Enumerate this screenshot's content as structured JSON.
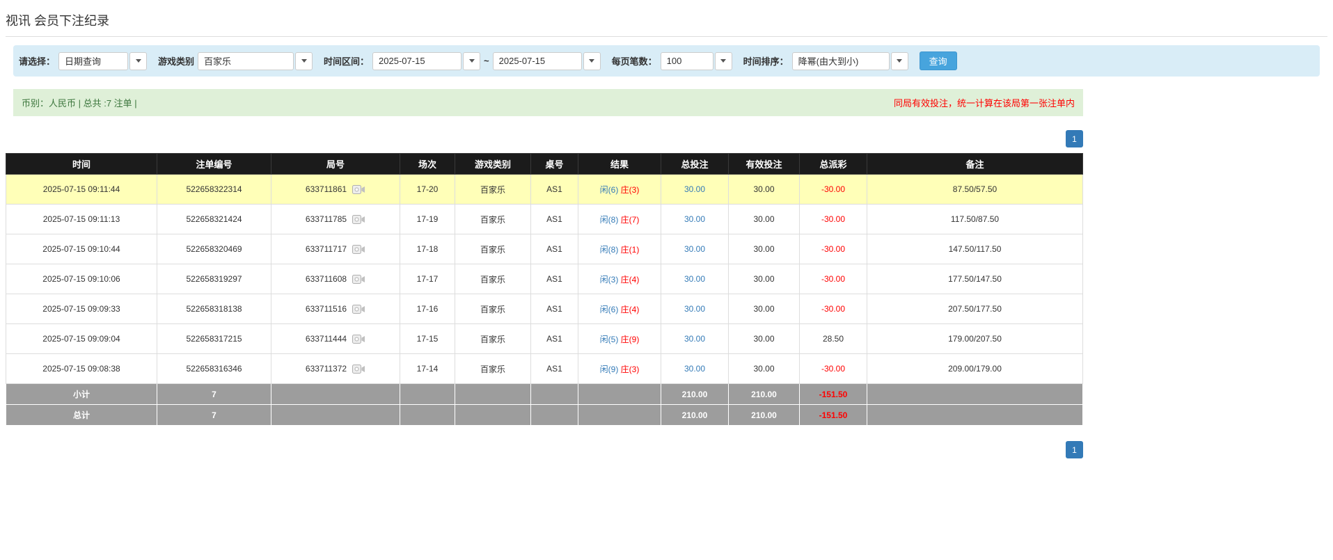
{
  "page": {
    "title": "视讯 会员下注纪录"
  },
  "filters": {
    "select_label": "请选择：",
    "select_value": "日期查询",
    "game_type_label": "游戏类别",
    "game_type_value": "百家乐",
    "date_range_label": "时间区间：",
    "date_from": "2025-07-15",
    "date_separator": "~",
    "date_to": "2025-07-15",
    "page_size_label": "每页笔数：",
    "page_size_value": "100",
    "sort_label": "时间排序：",
    "sort_value": "降幂(由大到小)",
    "search_button": "查询"
  },
  "summary": {
    "left_text": "币别：人民币 | 总共 :7 注单 |",
    "right_note": "同局有效投注，统一计算在该局第一张注单内"
  },
  "pagination": {
    "page": "1"
  },
  "icons": {
    "dropdown": "chevron-down-icon",
    "round_replay": "video-replay-icon"
  },
  "colors": {
    "filter_bar_blue": "#d9edf7",
    "summary_bar_green": "#dff0d8",
    "search_button_blue": "#47a4dd",
    "pagination_blue": "#337ab7",
    "link_blue": "#337ab7",
    "player_blue": "#337ab7",
    "banker_red": "#ff0000",
    "negative_red": "#ff0000",
    "note_red": "#ff0000",
    "highlight_yellow": "#ffffb8",
    "header_black": "#1b1b1b",
    "footer_gray": "#9d9d9d"
  },
  "table": {
    "headers": [
      "时间",
      "注单编号",
      "局号",
      "场次",
      "游戏类别",
      "桌号",
      "结果",
      "总投注",
      "有效投注",
      "总派彩",
      "备注"
    ],
    "rows": [
      {
        "time": "2025-07-15 09:11:44",
        "bet_id": "522658322314",
        "round": "633711861",
        "session": "17-20",
        "game": "百家乐",
        "table_no": "AS1",
        "result_xian": "闲(6)",
        "result_zhuang": "庄(3)",
        "total_bet": "30.00",
        "valid_bet": "30.00",
        "payout": "-30.00",
        "remark": "87.50/57.50",
        "highlight": true
      },
      {
        "time": "2025-07-15 09:11:13",
        "bet_id": "522658321424",
        "round": "633711785",
        "session": "17-19",
        "game": "百家乐",
        "table_no": "AS1",
        "result_xian": "闲(8)",
        "result_zhuang": "庄(7)",
        "total_bet": "30.00",
        "valid_bet": "30.00",
        "payout": "-30.00",
        "remark": "117.50/87.50",
        "highlight": false
      },
      {
        "time": "2025-07-15 09:10:44",
        "bet_id": "522658320469",
        "round": "633711717",
        "session": "17-18",
        "game": "百家乐",
        "table_no": "AS1",
        "result_xian": "闲(8)",
        "result_zhuang": "庄(1)",
        "total_bet": "30.00",
        "valid_bet": "30.00",
        "payout": "-30.00",
        "remark": "147.50/117.50",
        "highlight": false
      },
      {
        "time": "2025-07-15 09:10:06",
        "bet_id": "522658319297",
        "round": "633711608",
        "session": "17-17",
        "game": "百家乐",
        "table_no": "AS1",
        "result_xian": "闲(3)",
        "result_zhuang": "庄(4)",
        "total_bet": "30.00",
        "valid_bet": "30.00",
        "payout": "-30.00",
        "remark": "177.50/147.50",
        "highlight": false
      },
      {
        "time": "2025-07-15 09:09:33",
        "bet_id": "522658318138",
        "round": "633711516",
        "session": "17-16",
        "game": "百家乐",
        "table_no": "AS1",
        "result_xian": "闲(6)",
        "result_zhuang": "庄(4)",
        "total_bet": "30.00",
        "valid_bet": "30.00",
        "payout": "-30.00",
        "remark": "207.50/177.50",
        "highlight": false
      },
      {
        "time": "2025-07-15 09:09:04",
        "bet_id": "522658317215",
        "round": "633711444",
        "session": "17-15",
        "game": "百家乐",
        "table_no": "AS1",
        "result_xian": "闲(5)",
        "result_zhuang": "庄(9)",
        "total_bet": "30.00",
        "valid_bet": "30.00",
        "payout": "28.50",
        "remark": "179.00/207.50",
        "highlight": false
      },
      {
        "time": "2025-07-15 09:08:38",
        "bet_id": "522658316346",
        "round": "633711372",
        "session": "17-14",
        "game": "百家乐",
        "table_no": "AS1",
        "result_xian": "闲(9)",
        "result_zhuang": "庄(3)",
        "total_bet": "30.00",
        "valid_bet": "30.00",
        "payout": "-30.00",
        "remark": "209.00/179.00",
        "highlight": false
      }
    ],
    "subtotal": {
      "label": "小计",
      "count": "7",
      "total_bet": "210.00",
      "valid_bet": "210.00",
      "payout": "-151.50"
    },
    "total": {
      "label": "总计",
      "count": "7",
      "total_bet": "210.00",
      "valid_bet": "210.00",
      "payout": "-151.50"
    }
  }
}
